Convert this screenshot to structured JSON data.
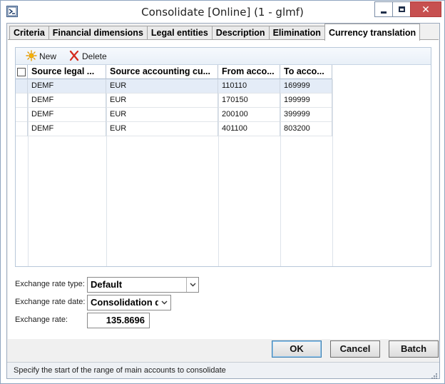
{
  "window": {
    "title": "Consolidate [Online] (1 - glmf)",
    "close_glyph": "✕"
  },
  "tabs": [
    {
      "label": "Criteria",
      "active": false
    },
    {
      "label": "Financial dimensions",
      "active": false
    },
    {
      "label": "Legal entities",
      "active": false
    },
    {
      "label": "Description",
      "active": false
    },
    {
      "label": "Elimination",
      "active": false
    },
    {
      "label": "Currency translation",
      "active": true
    }
  ],
  "toolbar": {
    "new_label": "New",
    "delete_label": "Delete"
  },
  "grid": {
    "columns": [
      "Source legal ...",
      "Source accounting cu...",
      "From acco...",
      "To acco..."
    ],
    "rows": [
      [
        "DEMF",
        "EUR",
        "110110",
        "169999"
      ],
      [
        "DEMF",
        "EUR",
        "170150",
        "199999"
      ],
      [
        "DEMF",
        "EUR",
        "200100",
        "399999"
      ],
      [
        "DEMF",
        "EUR",
        "401100",
        "803200"
      ]
    ],
    "selected_row": 0
  },
  "form": {
    "exchange_rate_type_label": "Exchange rate type:",
    "exchange_rate_type_value": "Default",
    "exchange_rate_date_label": "Exchange rate date:",
    "exchange_rate_date_value": "Consolidation d",
    "exchange_rate_label": "Exchange rate:",
    "exchange_rate_value": "135.8696"
  },
  "buttons": {
    "ok": "OK",
    "cancel": "Cancel",
    "batch": "Batch"
  },
  "status": {
    "text": "Specify the start of the range of main accounts to consolidate"
  },
  "colors": {
    "accent": "#3c7fb1",
    "close_button": "#c75050",
    "selected_row": "#e4ecf7"
  },
  "icons": {
    "new": "sun-new-icon",
    "delete": "red-x-delete-icon",
    "app": "app-window-icon"
  }
}
